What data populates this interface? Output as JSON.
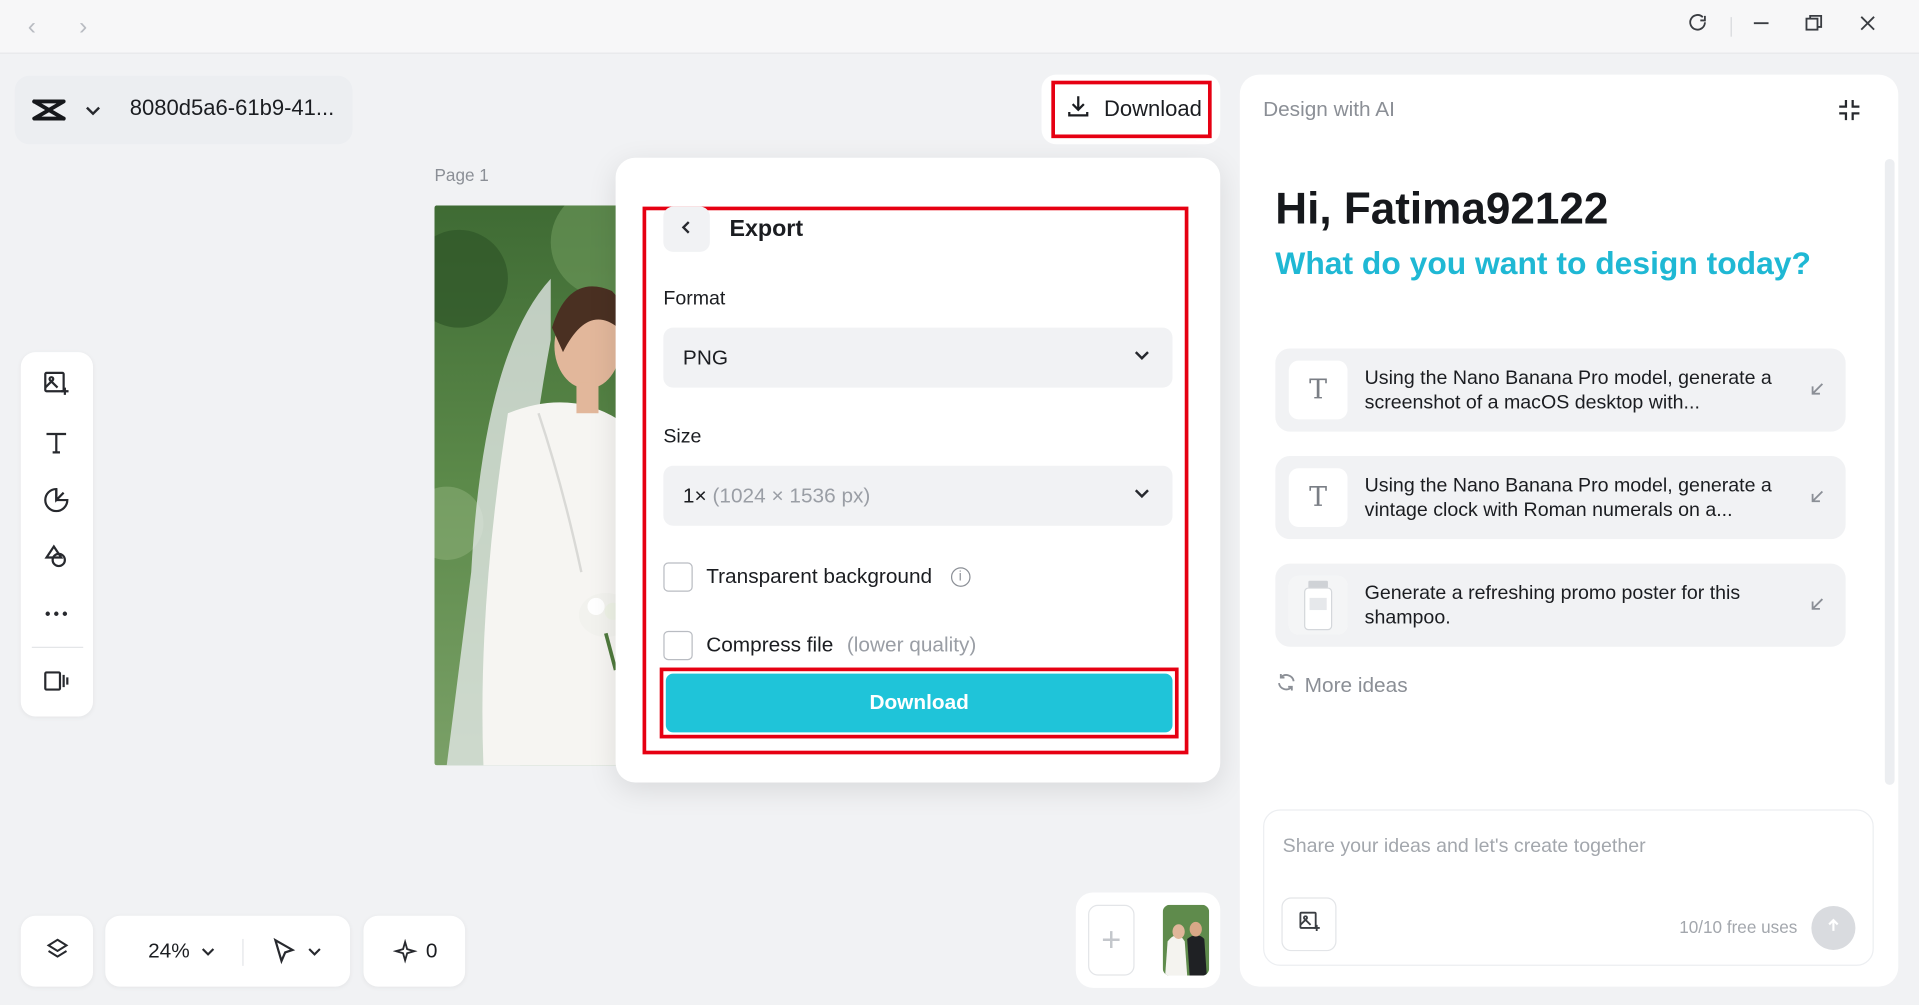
{
  "project": {
    "title": "8080d5a6-61b9-41..."
  },
  "canvas": {
    "page_label": "Page 1"
  },
  "toolbar": {
    "download_label": "Download"
  },
  "export": {
    "title": "Export",
    "format_label": "Format",
    "format_value": "PNG",
    "size_label": "Size",
    "size_scale": "1×",
    "size_dims": "(1024 × 1536 px)",
    "transparent_label": "Transparent background",
    "compress_label": "Compress file",
    "compress_note": "(lower quality)",
    "download_label": "Download"
  },
  "bottom": {
    "zoom": "24%",
    "credits": "0"
  },
  "ai": {
    "header": "Design with AI",
    "greeting": "Hi, Fatima92122",
    "subtitle": "What do you want to design today?",
    "ideas": [
      {
        "text": "Using the Nano Banana Pro model, generate a screenshot of a macOS desktop with...",
        "icon": "text-T-icon"
      },
      {
        "text": "Using the Nano Banana Pro model, generate a vintage clock with Roman numerals on a...",
        "icon": "text-T-icon"
      },
      {
        "text": "Generate a refreshing promo poster for this shampoo.",
        "icon": "shampoo-thumbnail"
      }
    ],
    "more_ideas": "More ideas",
    "prompt_placeholder": "Share your ideas and let's create together",
    "free_uses": "10/10 free uses"
  },
  "colors": {
    "accent": "#1fc4d9",
    "heading_accent": "#1fb8d4",
    "highlight": "#e60012"
  }
}
